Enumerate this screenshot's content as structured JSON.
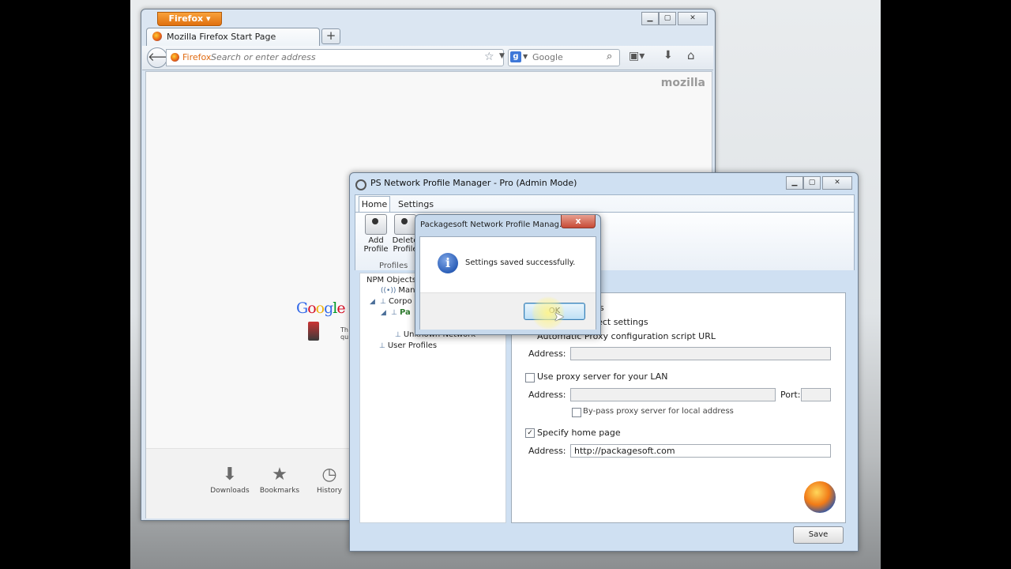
{
  "firefox": {
    "app_button": "Firefox ▾",
    "tab_title": "Mozilla Firefox Start Page",
    "new_tab_symbol": "+",
    "identity_label": "Firefox",
    "address_placeholder": "Search or enter address",
    "search_engine_letter": "g",
    "search_placeholder": "Google",
    "brand": "mozilla",
    "google_logo": "Google",
    "snippet_text": "Th\nqu",
    "launcher": [
      {
        "label": "Downloads",
        "icon": "download-icon"
      },
      {
        "label": "Bookmarks",
        "icon": "star-icon"
      },
      {
        "label": "History",
        "icon": "clock-icon"
      }
    ]
  },
  "npm": {
    "title": "PS Network Profile Manager - Pro (Admin Mode)",
    "tabs": [
      "Home",
      "Settings"
    ],
    "ribbon": {
      "buttons": [
        "Add\nProfile",
        "Delete\nProfile"
      ],
      "group_label": "Profiles"
    },
    "tree": [
      {
        "label": "NPM Objects",
        "icon": ""
      },
      {
        "label": "Mana",
        "icon": "wireless-icon"
      },
      {
        "label": "Corpo",
        "icon": "network-icon"
      },
      {
        "label": "Pa",
        "icon": "network-icon"
      },
      {
        "label": "Unknown Network",
        "icon": "network-icon"
      },
      {
        "label": "User Profiles",
        "icon": "user-icon"
      }
    ],
    "panel": {
      "partial_settings": "ngs",
      "auto_detect": "etect settings",
      "auto_script": "Automatic Proxy configuration script URL",
      "address_label": "Address:",
      "script_address": "",
      "use_proxy": "Use proxy server for your LAN",
      "proxy_address": "",
      "port_label": "Port:",
      "port_value": "",
      "bypass": "By-pass proxy server for local address",
      "specify_home": "Specify home page",
      "home_address": "http://packagesoft.com"
    },
    "save_label": "Save"
  },
  "dialog": {
    "title": "Packagesoft Network Profile Manag...",
    "close_symbol": "x",
    "info_symbol": "i",
    "message": "Settings saved successfully.",
    "ok_label": "OK"
  }
}
